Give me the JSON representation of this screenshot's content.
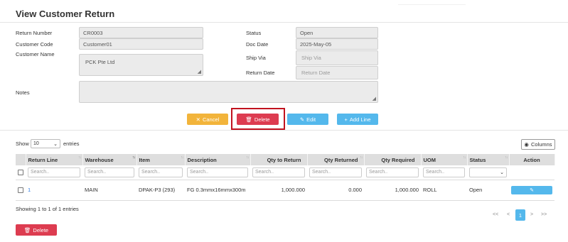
{
  "page_title": "View Customer Return",
  "form": {
    "return_number": {
      "label": "Return Number",
      "value": "CR0003"
    },
    "customer_code": {
      "label": "Customer Code",
      "value": "Customer01"
    },
    "customer_name": {
      "label": "Customer Name",
      "value": "PCK Pte Ltd"
    },
    "notes": {
      "label": "Notes",
      "value": ""
    },
    "status": {
      "label": "Status",
      "value": "Open"
    },
    "doc_date": {
      "label": "Doc Date",
      "value": "2025-May-05"
    },
    "ship_via": {
      "label": "Ship Via",
      "placeholder": "Ship Via"
    },
    "return_date": {
      "label": "Return Date",
      "placeholder": "Return Date"
    }
  },
  "actions": {
    "cancel": "Cancel",
    "delete": "Delete",
    "edit": "Edit",
    "add_line": "Add Line"
  },
  "table_controls": {
    "show_label": "Show",
    "page_size": "10",
    "entries_label": "entries",
    "columns_button": "Columns"
  },
  "table": {
    "columns": [
      "Return Line",
      "Warehouse",
      "Item",
      "Description",
      "Qty to Return",
      "Qty Returned",
      "Qty Required",
      "UOM",
      "Status",
      "Action"
    ],
    "search_placeholder": "Search..",
    "rows": [
      {
        "return_line": "1",
        "warehouse": "MAIN",
        "item": "DPAK-P3 (293)",
        "description": "FG 0.3mmx16mmx300m",
        "qty_to_return": "1,000.000",
        "qty_returned": "0.000",
        "qty_required": "1,000.000",
        "uom": "ROLL",
        "status": "Open"
      }
    ]
  },
  "footer": {
    "info": "Showing 1 to 1 of 1 entries",
    "pagination": {
      "first": "<<",
      "prev": "<",
      "current": "1",
      "next": ">",
      "last": ">>"
    },
    "delete_button": "Delete"
  },
  "colors": {
    "danger": "#dd3c50",
    "warning": "#f2b43b",
    "info": "#54b8ec",
    "highlight": "#c1121f"
  }
}
